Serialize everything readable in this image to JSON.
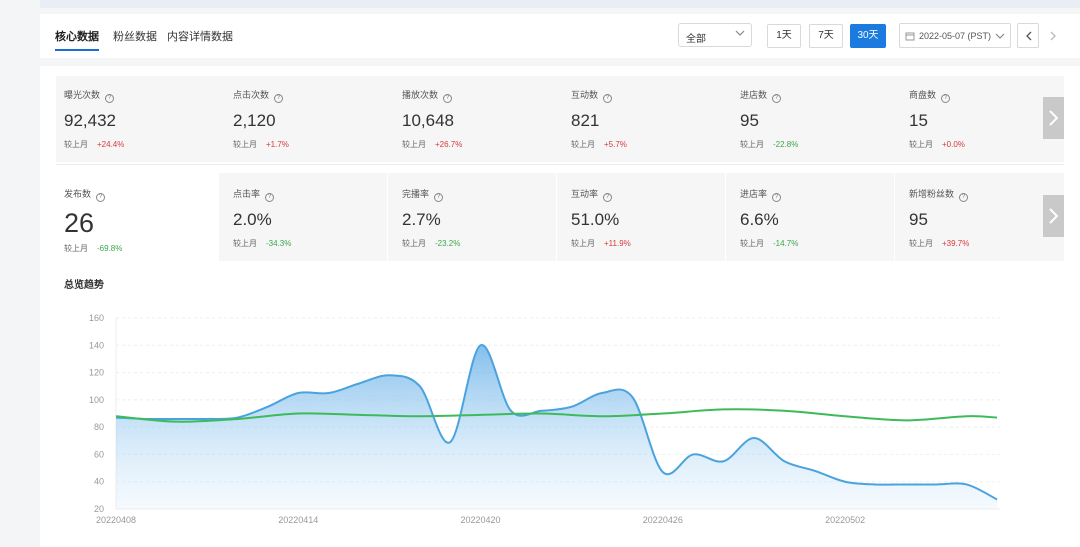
{
  "tabs": [
    {
      "label": "核心数据",
      "active": true
    },
    {
      "label": "粉丝数据",
      "active": false
    },
    {
      "label": "内容详情数据",
      "active": false
    }
  ],
  "filter": {
    "selected": "全部"
  },
  "ranges": [
    {
      "label": "1天",
      "selected": false
    },
    {
      "label": "7天",
      "selected": false
    },
    {
      "label": "30天",
      "selected": true
    }
  ],
  "date": {
    "value": "2022-05-07 (PST)"
  },
  "comp_label": "较上月",
  "metrics_row1": [
    {
      "label": "曝光次数",
      "value": "92,432",
      "change": "+24.4%",
      "dir": "up"
    },
    {
      "label": "点击次数",
      "value": "2,120",
      "change": "+1.7%",
      "dir": "up"
    },
    {
      "label": "播放次数",
      "value": "10,648",
      "change": "+26.7%",
      "dir": "up"
    },
    {
      "label": "互动数",
      "value": "821",
      "change": "+5.7%",
      "dir": "up"
    },
    {
      "label": "进店数",
      "value": "95",
      "change": "-22.8%",
      "dir": "down"
    },
    {
      "label": "商盘数",
      "value": "15",
      "change": "+0.0%",
      "dir": "up"
    }
  ],
  "metrics_row2": [
    {
      "label": "发布数",
      "value": "26",
      "change": "-69.8%",
      "dir": "down"
    },
    {
      "label": "点击率",
      "value": "2.0%",
      "change": "-34.3%",
      "dir": "down"
    },
    {
      "label": "完播率",
      "value": "2.7%",
      "change": "-23.2%",
      "dir": "down"
    },
    {
      "label": "互动率",
      "value": "51.0%",
      "change": "+11.9%",
      "dir": "up"
    },
    {
      "label": "进店率",
      "value": "6.6%",
      "change": "-14.7%",
      "dir": "down"
    },
    {
      "label": "新增粉丝数",
      "value": "95",
      "change": "+39.7%",
      "dir": "up"
    }
  ],
  "chart_title": "总览趋势",
  "colors": {
    "accent": "#1a7ae0",
    "up": "#d93a3a",
    "down": "#3aa84a",
    "series_blue": "#4aa3df",
    "series_green": "#3dba5a"
  },
  "chart_data": {
    "type": "area",
    "title": "总览趋势",
    "ylim": [
      20,
      160
    ],
    "yticks": [
      "20",
      "40",
      "60",
      "80",
      "100",
      "120",
      "140",
      "160"
    ],
    "xlim": [
      0,
      29
    ],
    "xtick_positions": [
      0,
      6,
      12,
      18,
      24
    ],
    "xticks": [
      "20220408",
      "20220414",
      "20220420",
      "20220426",
      "20220502"
    ],
    "grid": true,
    "series": [
      {
        "color": "#4aa3df",
        "fill": true,
        "points": [
          [
            0,
            87
          ],
          [
            1,
            86
          ],
          [
            2,
            86
          ],
          [
            3,
            86
          ],
          [
            4,
            87
          ],
          [
            5,
            95
          ],
          [
            6,
            105
          ],
          [
            7,
            105
          ],
          [
            8,
            112
          ],
          [
            9,
            118
          ],
          [
            10,
            110
          ],
          [
            11,
            69
          ],
          [
            12,
            140
          ],
          [
            13,
            92
          ],
          [
            14,
            92
          ],
          [
            15,
            95
          ],
          [
            16,
            105
          ],
          [
            17,
            102
          ],
          [
            18,
            47
          ],
          [
            19,
            60
          ],
          [
            20,
            55
          ],
          [
            21,
            72
          ],
          [
            22,
            55
          ],
          [
            23,
            48
          ],
          [
            24,
            40
          ],
          [
            25,
            38
          ],
          [
            26,
            38
          ],
          [
            27,
            38
          ],
          [
            28,
            38
          ],
          [
            29,
            27
          ]
        ]
      },
      {
        "color": "#3dba5a",
        "fill": false,
        "points": [
          [
            0,
            88
          ],
          [
            2,
            84
          ],
          [
            4,
            86
          ],
          [
            6,
            90
          ],
          [
            8,
            89
          ],
          [
            10,
            88
          ],
          [
            12,
            89
          ],
          [
            14,
            90
          ],
          [
            16,
            88
          ],
          [
            18,
            90
          ],
          [
            20,
            93
          ],
          [
            22,
            92
          ],
          [
            24,
            88
          ],
          [
            26,
            85
          ],
          [
            28,
            88
          ],
          [
            29,
            87
          ]
        ]
      }
    ]
  }
}
